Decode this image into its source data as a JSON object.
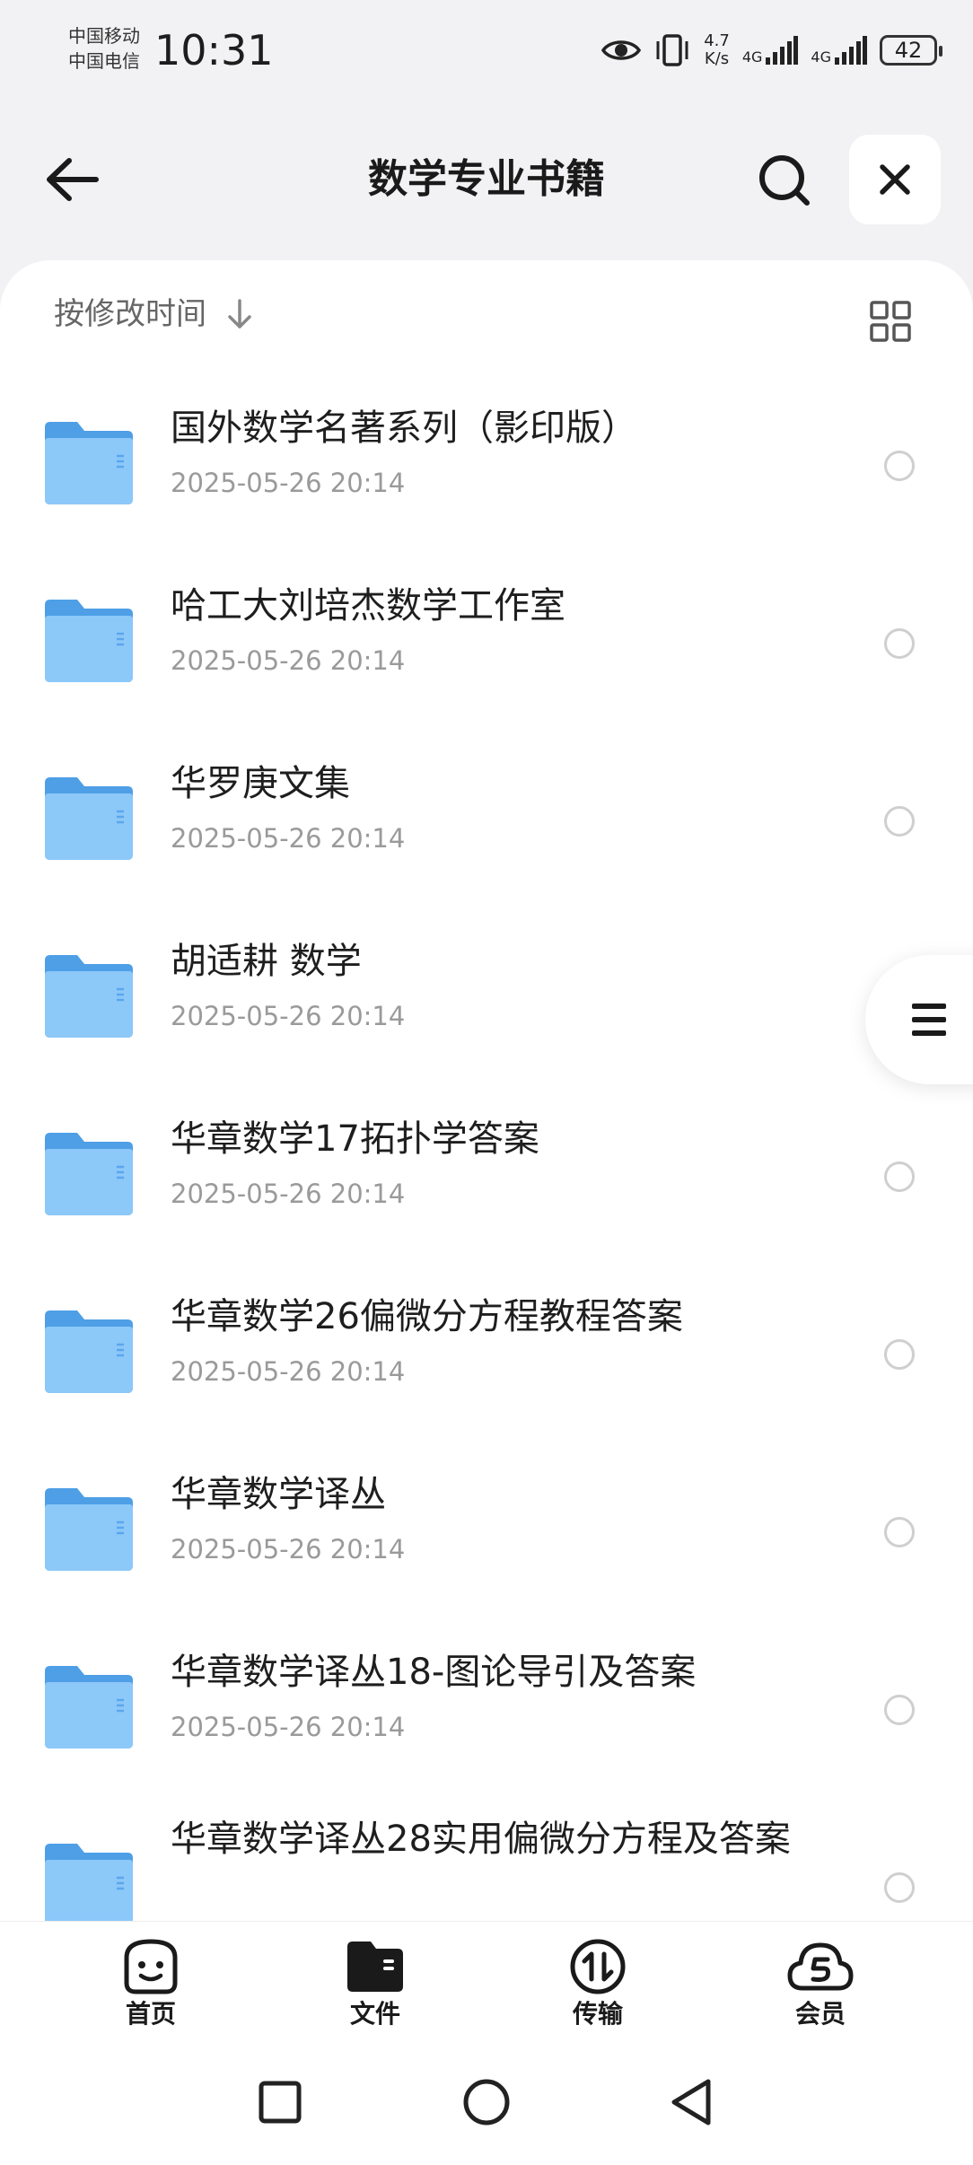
{
  "status_bar": {
    "carrier_1": "中国移动",
    "carrier_2": "中国电信",
    "time": "10:31",
    "speed_value": "4.7",
    "speed_unit": "K/s",
    "network_1": "4G",
    "network_2": "4G",
    "battery": "42"
  },
  "header": {
    "title": "数学专业书籍",
    "icons": {
      "back": "arrow-left-icon",
      "search": "search-icon",
      "close": "close-icon"
    }
  },
  "sort": {
    "label": "按修改时间",
    "icon": "arrow-down-icon",
    "view_icon": "grid-view-icon"
  },
  "items": [
    {
      "name": "国外数学名著系列（影印版）",
      "date": "2025-05-26 20:14"
    },
    {
      "name": "哈工大刘培杰数学工作室",
      "date": "2025-05-26 20:14"
    },
    {
      "name": "华罗庚文集",
      "date": "2025-05-26 20:14"
    },
    {
      "name": "胡适耕 数学",
      "date": "2025-05-26 20:14"
    },
    {
      "name": "华章数学17拓扑学答案",
      "date": "2025-05-26 20:14"
    },
    {
      "name": "华章数学26偏微分方程教程答案",
      "date": "2025-05-26 20:14"
    },
    {
      "name": "华章数学译丛",
      "date": "2025-05-26 20:14"
    },
    {
      "name": "华章数学译丛18-图论导引及答案",
      "date": "2025-05-26 20:14"
    },
    {
      "name": "华章数学译丛28实用偏微分方程及答案",
      "date": ""
    }
  ],
  "bottom_nav": [
    {
      "label": "首页",
      "icon": "smiley-home-icon"
    },
    {
      "label": "文件",
      "icon": "folder-files-icon"
    },
    {
      "label": "传输",
      "icon": "transfer-icon"
    },
    {
      "label": "会员",
      "icon": "cloud-vip-icon"
    }
  ],
  "colors": {
    "background": "#f2f2f4",
    "panel": "#ffffff",
    "folder_blue": "#5aabf0",
    "text_primary": "#1e1e1e",
    "text_secondary": "#9a9a9a"
  }
}
